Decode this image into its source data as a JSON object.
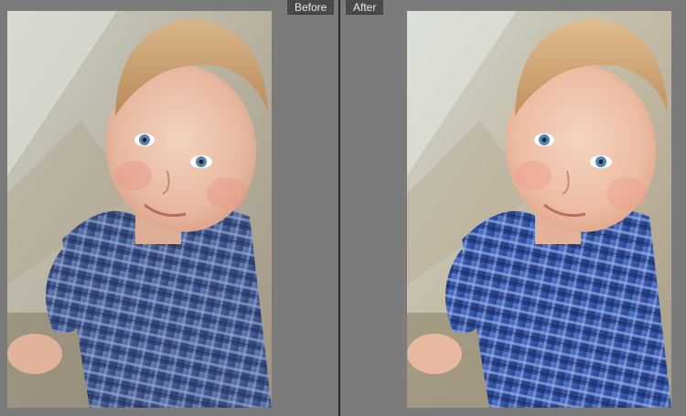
{
  "view": {
    "before_label": "Before",
    "after_label": "After"
  },
  "colors": {
    "background": "#7b7b7b",
    "divider": "#2a2a2a",
    "label_bg": "#4a4a4a",
    "label_text": "#e8e8e8"
  },
  "photos": {
    "before": {
      "subject": "child-portrait",
      "variant": "original"
    },
    "after": {
      "subject": "child-portrait",
      "variant": "edited"
    }
  }
}
